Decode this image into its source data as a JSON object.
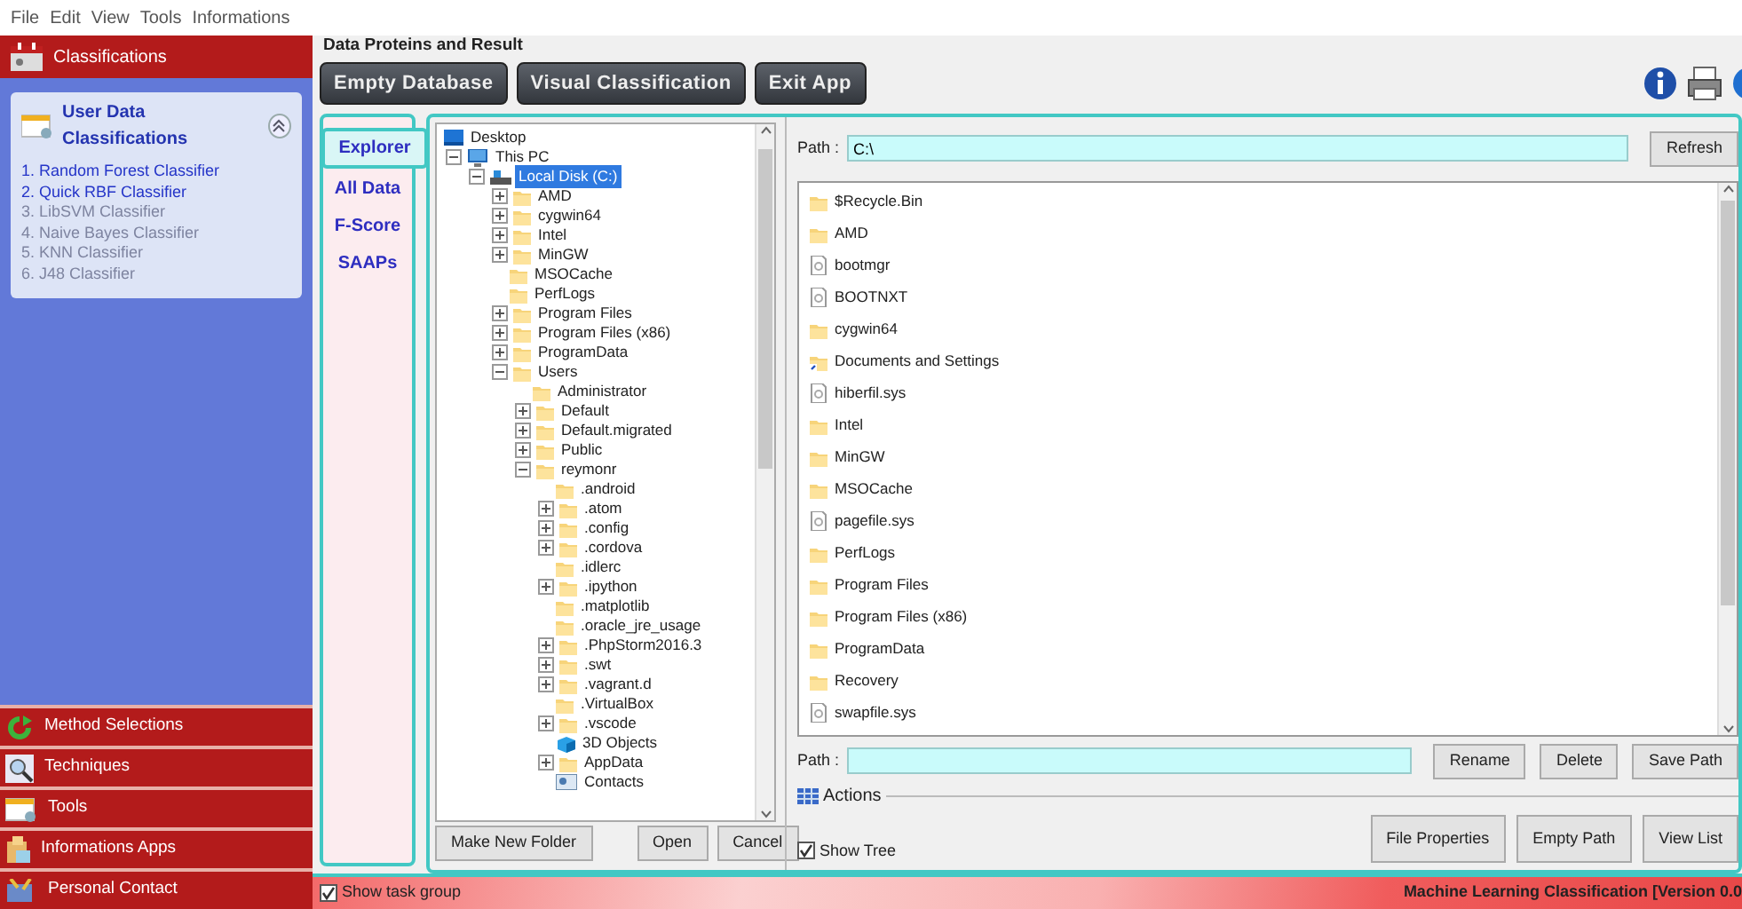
{
  "menu": [
    "File",
    "Edit",
    "View",
    "Tools",
    "Informations"
  ],
  "sidebar": {
    "header": "Classifications",
    "panel": {
      "title": "User Data Classifications",
      "expanded": true,
      "items": [
        {
          "label": "1. Random Forest Classifier",
          "disabled": false
        },
        {
          "label": "2. Quick RBF Classifier",
          "disabled": false
        },
        {
          "label": "3. LibSVM Classifier",
          "disabled": true
        },
        {
          "label": "4. Naive Bayes Classifier",
          "disabled": true
        },
        {
          "label": "5. KNN Classifier",
          "disabled": true
        },
        {
          "label": "6. J48 Classifier",
          "disabled": true
        }
      ]
    },
    "sections": [
      {
        "label": "Method Selections",
        "kind": "method"
      },
      {
        "label": "Techniques",
        "kind": "search"
      },
      {
        "label": "Tools",
        "kind": "window"
      },
      {
        "label": "Informations Apps",
        "kind": "info"
      },
      {
        "label": "Personal Contact",
        "kind": "contact"
      }
    ]
  },
  "main": {
    "group_title": "Data Proteins and Result",
    "toolbar": [
      "Empty Database",
      "Visual Classification",
      "Exit App"
    ],
    "tabs": [
      {
        "label": "Explorer",
        "selected": true
      },
      {
        "label": "All Data",
        "selected": false
      },
      {
        "label": "F-Score",
        "selected": false
      },
      {
        "label": "SAAPs",
        "selected": false
      }
    ],
    "tree": [
      {
        "label": "Desktop",
        "kind": "desktop",
        "selected": false,
        "children": [
          {
            "label": "This PC",
            "kind": "pc",
            "selected": false,
            "expanded": true,
            "children": [
              {
                "label": "Local Disk (C:)",
                "kind": "drive",
                "selected": true,
                "expanded": true,
                "children": [
                  {
                    "label": "AMD",
                    "kind": "folder",
                    "selected": false,
                    "expanded": false
                  },
                  {
                    "label": "cygwin64",
                    "kind": "folder",
                    "selected": false,
                    "expanded": false
                  },
                  {
                    "label": "Intel",
                    "kind": "folder",
                    "selected": false,
                    "expanded": false
                  },
                  {
                    "label": "MinGW",
                    "kind": "folder",
                    "selected": false,
                    "expanded": false
                  },
                  {
                    "label": "MSOCache",
                    "kind": "folder",
                    "selected": false
                  },
                  {
                    "label": "PerfLogs",
                    "kind": "folder",
                    "selected": false
                  },
                  {
                    "label": "Program Files",
                    "kind": "folder",
                    "selected": false,
                    "expanded": false
                  },
                  {
                    "label": "Program Files (x86)",
                    "kind": "folder",
                    "selected": false,
                    "expanded": false
                  },
                  {
                    "label": "ProgramData",
                    "kind": "folder",
                    "selected": false,
                    "expanded": false
                  },
                  {
                    "label": "Users",
                    "kind": "folder",
                    "selected": false,
                    "expanded": true,
                    "children": [
                      {
                        "label": "Administrator",
                        "kind": "folder",
                        "selected": false
                      },
                      {
                        "label": "Default",
                        "kind": "folder",
                        "selected": false,
                        "expanded": false
                      },
                      {
                        "label": "Default.migrated",
                        "kind": "folder",
                        "selected": false,
                        "expanded": false
                      },
                      {
                        "label": "Public",
                        "kind": "folder",
                        "selected": false,
                        "expanded": false
                      },
                      {
                        "label": "reymonr",
                        "kind": "folder",
                        "selected": false,
                        "expanded": true,
                        "children": [
                          {
                            "label": ".android",
                            "kind": "folder",
                            "selected": false
                          },
                          {
                            "label": ".atom",
                            "kind": "folder",
                            "selected": false,
                            "expanded": false
                          },
                          {
                            "label": ".config",
                            "kind": "folder",
                            "selected": false,
                            "expanded": false
                          },
                          {
                            "label": ".cordova",
                            "kind": "folder",
                            "selected": false,
                            "expanded": false
                          },
                          {
                            "label": ".idlerc",
                            "kind": "folder",
                            "selected": false
                          },
                          {
                            "label": ".ipython",
                            "kind": "folder",
                            "selected": false,
                            "expanded": false
                          },
                          {
                            "label": ".matplotlib",
                            "kind": "folder",
                            "selected": false
                          },
                          {
                            "label": ".oracle_jre_usage",
                            "kind": "folder",
                            "selected": false
                          },
                          {
                            "label": ".PhpStorm2016.3",
                            "kind": "folder",
                            "selected": false,
                            "expanded": false
                          },
                          {
                            "label": ".swt",
                            "kind": "folder",
                            "selected": false,
                            "expanded": false
                          },
                          {
                            "label": ".vagrant.d",
                            "kind": "folder",
                            "selected": false,
                            "expanded": false
                          },
                          {
                            "label": ".VirtualBox",
                            "kind": "folder",
                            "selected": false
                          },
                          {
                            "label": ".vscode",
                            "kind": "folder",
                            "selected": false,
                            "expanded": false
                          },
                          {
                            "label": "3D Objects",
                            "kind": "objects",
                            "selected": false
                          },
                          {
                            "label": "AppData",
                            "kind": "folder",
                            "selected": false,
                            "expanded": false
                          },
                          {
                            "label": "Contacts",
                            "kind": "contacts",
                            "selected": false
                          }
                        ]
                      }
                    ]
                  }
                ]
              }
            ]
          }
        ]
      }
    ],
    "tree_buttons": [
      "Make New Folder",
      "Open",
      "Cancel"
    ],
    "path": {
      "label": "Path :",
      "value": "C:\\"
    },
    "refresh": "Refresh",
    "files": [
      {
        "name": "$Recycle.Bin",
        "kind": "folder"
      },
      {
        "name": "AMD",
        "kind": "folder"
      },
      {
        "name": "bootmgr",
        "kind": "file"
      },
      {
        "name": "BOOTNXT",
        "kind": "file"
      },
      {
        "name": "cygwin64",
        "kind": "folder"
      },
      {
        "name": "Documents and Settings",
        "kind": "shortcut"
      },
      {
        "name": "hiberfil.sys",
        "kind": "file"
      },
      {
        "name": "Intel",
        "kind": "folder"
      },
      {
        "name": "MinGW",
        "kind": "folder"
      },
      {
        "name": "MSOCache",
        "kind": "folder"
      },
      {
        "name": "pagefile.sys",
        "kind": "file"
      },
      {
        "name": "PerfLogs",
        "kind": "folder"
      },
      {
        "name": "Program Files",
        "kind": "folder"
      },
      {
        "name": "Program Files (x86)",
        "kind": "folder"
      },
      {
        "name": "ProgramData",
        "kind": "folder"
      },
      {
        "name": "Recovery",
        "kind": "folder"
      },
      {
        "name": "swapfile.sys",
        "kind": "file"
      }
    ],
    "path2": {
      "label": "Path :"
    },
    "path2_buttons": [
      "Rename",
      "Delete",
      "Save Path"
    ],
    "actions_label": "Actions",
    "show_tree": {
      "label": "Show Tree",
      "checked": true
    },
    "action_buttons": [
      "File Properties",
      "Empty Path",
      "View List"
    ]
  },
  "status_bar": {
    "show_task_group": {
      "label": "Show task group",
      "checked": true
    },
    "title": "Machine Learning Classification [Version 0.0"
  }
}
